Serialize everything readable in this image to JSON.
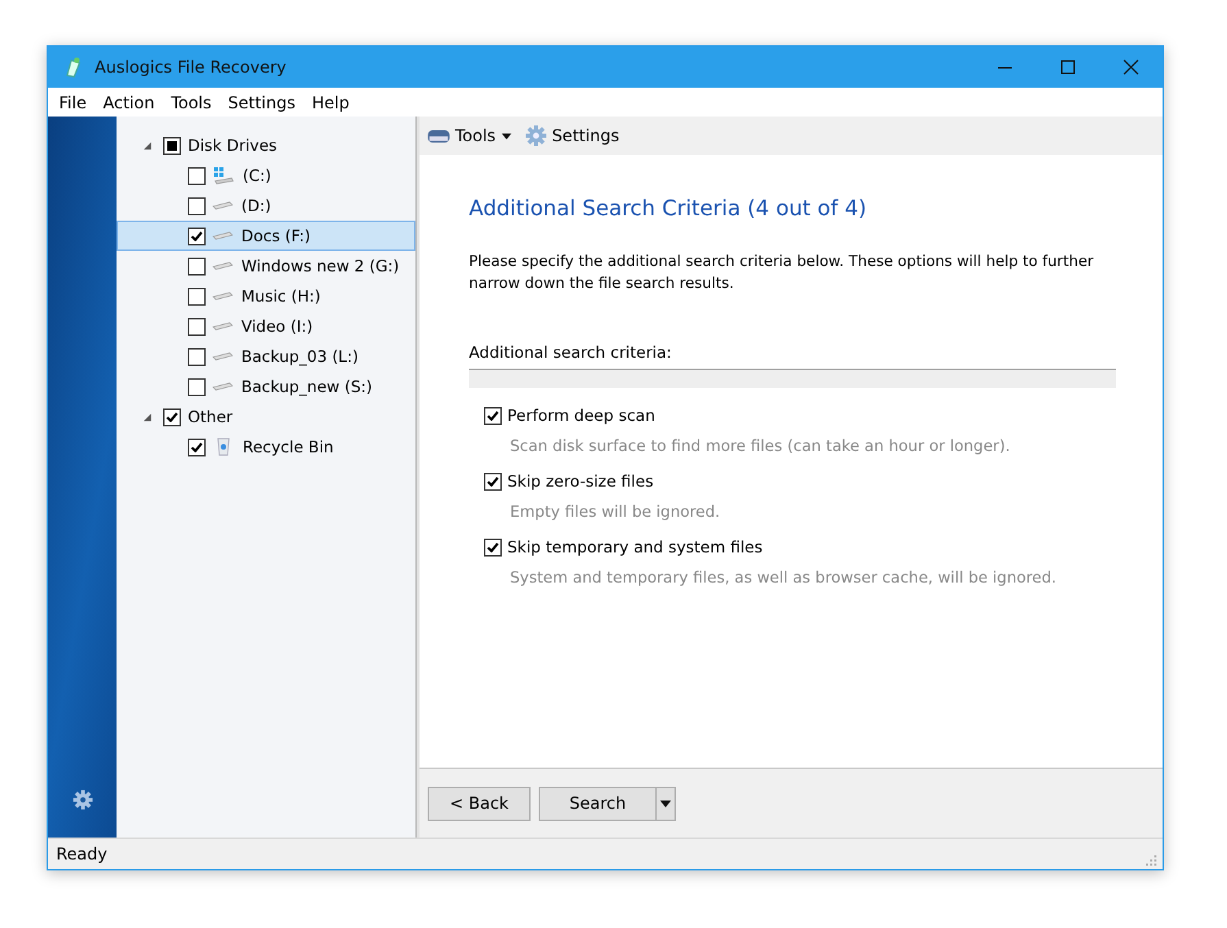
{
  "window": {
    "title": "Auslogics File Recovery"
  },
  "menu": [
    "File",
    "Action",
    "Tools",
    "Settings",
    "Help"
  ],
  "tree": [
    {
      "label": "Disk Drives",
      "checked": false,
      "mixed": true,
      "expanded": true,
      "selected": false,
      "children": [
        {
          "label": "(C:)",
          "kind": "system-drive",
          "checked": false,
          "selected": false
        },
        {
          "label": "(D:)",
          "kind": "drive",
          "checked": false,
          "selected": false
        },
        {
          "label": "Docs (F:)",
          "kind": "drive",
          "checked": true,
          "selected": true
        },
        {
          "label": "Windows new 2 (G:)",
          "kind": "drive",
          "checked": false,
          "selected": false
        },
        {
          "label": "Music (H:)",
          "kind": "drive",
          "checked": false,
          "selected": false
        },
        {
          "label": "Video (I:)",
          "kind": "drive",
          "checked": false,
          "selected": false
        },
        {
          "label": "Backup_03 (L:)",
          "kind": "drive",
          "checked": false,
          "selected": false
        },
        {
          "label": "Backup_new (S:)",
          "kind": "drive",
          "checked": false,
          "selected": false
        }
      ]
    },
    {
      "label": "Other",
      "checked": true,
      "expanded": true,
      "selected": false,
      "children": [
        {
          "label": "Recycle Bin",
          "kind": "recycle-bin",
          "checked": true,
          "selected": false
        }
      ]
    }
  ],
  "toolbar": {
    "tools": "Tools",
    "settings": "Settings"
  },
  "heading": "Additional Search Criteria (4 out of 4)",
  "intro": "Please specify the additional search criteria below. These options will help to further narrow down the file search results.",
  "section_label": "Additional search criteria:",
  "options": [
    {
      "label": "Perform deep scan",
      "checked": true,
      "hint": "Scan disk surface to find more files (can take an hour or longer)."
    },
    {
      "label": "Skip zero-size files",
      "checked": true,
      "hint": "Empty files will be ignored."
    },
    {
      "label": "Skip temporary and system files",
      "checked": true,
      "hint": "System and temporary files, as well as browser cache, will be ignored."
    }
  ],
  "buttons": {
    "back": "< Back",
    "search": "Search"
  },
  "status_bar": "Ready"
}
